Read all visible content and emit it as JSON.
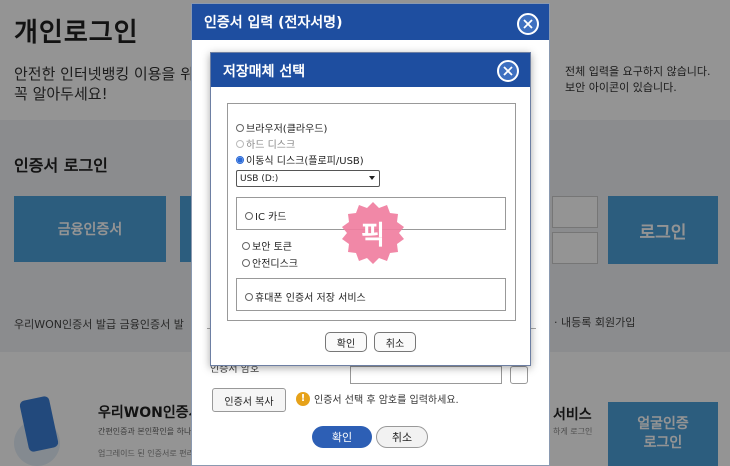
{
  "background": {
    "title": "개인로그인",
    "desc_line1": "안전한 인터넷뱅킹 이용을 위",
    "desc_line2": "꼭 알아두세요!",
    "desc_right_line1": "전체 입력을 요구하지 않습니다.",
    "desc_right_line2": "보안 아이콘이 있습니다.",
    "section": "인증서 로그인",
    "cert_button": "금융인증서",
    "login_button": "로그인",
    "links_left": "우리WON인증서 발급   금융인증서 발",
    "links_right": "· 내등록   회원가입",
    "won_title": "우리WON인증서",
    "won_sub": "간편인증과 본인확인을 하나로",
    "won_sub2": "업그레이드 된 인증서로 편리한 이용",
    "svc_title": "서비스",
    "svc_sub": "하게 로그인",
    "face_button_line1": "얼굴인증",
    "face_button_line2": "로그인"
  },
  "outer_dialog": {
    "title": "인증서 입력 (전자서명)",
    "password_label": "인증서 암호",
    "cert_view_button": "인증서 복사",
    "warning": "인증서 선택 후 암호를 입력하세요.",
    "ok_button": "확인",
    "cancel_button": "취소"
  },
  "inner_dialog": {
    "title": "저장매체 선택",
    "options": {
      "browser": "브라우저(클라우드)",
      "hard_disk": "하드 디스크",
      "removable": "이동식 디스크(플로피/USB)",
      "ic_card": "IC 카드",
      "security_token": "보안 토큰",
      "safe_disk": "안전디스크",
      "phone_storage": "휴대폰 인증서 저장 서비스"
    },
    "selected_option": "removable",
    "drive_select": "USB (D:)",
    "ok_button": "확인",
    "cancel_button": "취소"
  },
  "stamp": {
    "text": "픽",
    "color": "#f07ea0"
  },
  "colors": {
    "dialog_header": "#1e4ea0",
    "primary_button": "#4ca0d9"
  }
}
